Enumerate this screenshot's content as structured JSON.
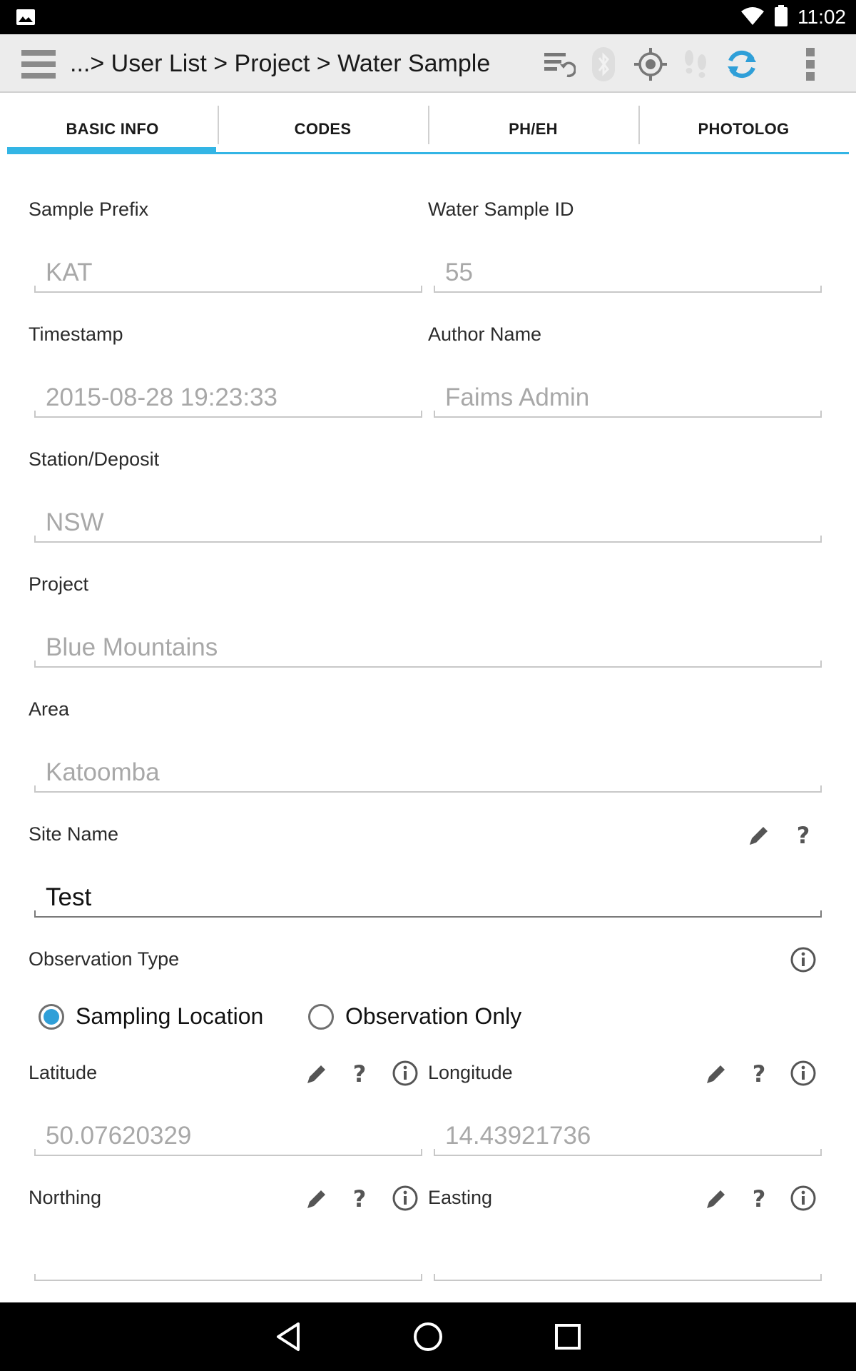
{
  "status_bar": {
    "time": "11:02"
  },
  "action_bar": {
    "breadcrumb": "...> User List > Project > Water Sample",
    "icons": [
      "menu-icon",
      "sync-settings-icon",
      "bluetooth-icon",
      "gps-target-icon",
      "footsteps-icon",
      "refresh-icon",
      "overflow-menu-icon"
    ],
    "accent_color": "#33b5e5"
  },
  "tabs": [
    {
      "label": "BASIC INFO",
      "active": true
    },
    {
      "label": "CODES",
      "active": false
    },
    {
      "label": "PH/EH",
      "active": false
    },
    {
      "label": "PHOTOLOG",
      "active": false
    }
  ],
  "form": {
    "sample_prefix": {
      "label": "Sample Prefix",
      "value": "KAT"
    },
    "water_sample_id": {
      "label": "Water Sample ID",
      "value": "55"
    },
    "timestamp": {
      "label": "Timestamp",
      "value": "2015-08-28 19:23:33"
    },
    "author_name": {
      "label": "Author Name",
      "value": "Faims Admin"
    },
    "station_deposit": {
      "label": "Station/Deposit",
      "value": "NSW"
    },
    "project": {
      "label": "Project",
      "value": "Blue Mountains"
    },
    "area": {
      "label": "Area",
      "value": "Katoomba"
    },
    "site_name": {
      "label": "Site Name",
      "value": "Test"
    },
    "observation_type": {
      "label": "Observation Type",
      "options": [
        "Sampling Location",
        "Observation Only"
      ],
      "selected": "Sampling Location"
    },
    "latitude": {
      "label": "Latitude",
      "value": "50.07620329"
    },
    "longitude": {
      "label": "Longitude",
      "value": "14.43921736"
    },
    "northing": {
      "label": "Northing",
      "value": ""
    },
    "easting": {
      "label": "Easting",
      "value": ""
    },
    "help_glyph": "?"
  }
}
